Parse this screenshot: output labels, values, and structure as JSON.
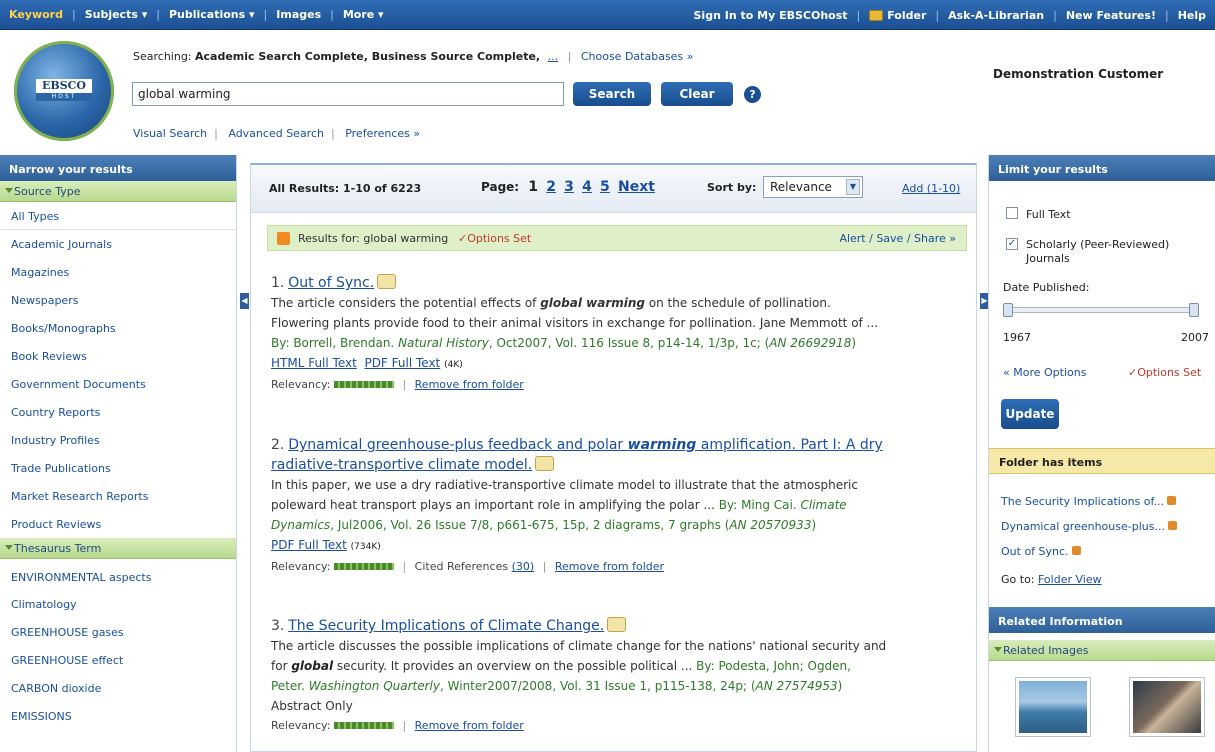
{
  "topnav": {
    "items": [
      "Keyword",
      "Subjects ▾",
      "Publications ▾",
      "Images",
      "More ▾"
    ],
    "right_items": [
      "Sign In to My EBSCOhost",
      "Folder",
      "Ask-A-Librarian",
      "New Features!",
      "Help"
    ]
  },
  "header": {
    "logo_top": "EBSCO",
    "logo_bottom": "HOST",
    "searching_label": "Searching:",
    "databases": "Academic Search Complete, Business Source Complete,",
    "more_ellipsis": "...",
    "choose_databases": "Choose Databases »",
    "search_value": "global warming",
    "search_button": "Search",
    "clear_button": "Clear",
    "help_icon": "?",
    "visual_search": "Visual Search",
    "advanced_search": "Advanced Search",
    "preferences": "Preferences »",
    "customer": "Demonstration Customer"
  },
  "left": {
    "title": "Narrow your results",
    "source_type_title": "Source Type",
    "source_types": [
      "All Types",
      "Academic Journals",
      "Magazines",
      "Newspapers",
      "Books/Monographs",
      "Book Reviews",
      "Government Documents",
      "Country Reports",
      "Industry Profiles",
      "Trade Publications",
      "Market Research Reports",
      "Product Reviews"
    ],
    "thesaurus_title": "Thesaurus Term",
    "thesaurus_terms": [
      "ENVIRONMENTAL aspects",
      "Climatology",
      "GREENHOUSE gases",
      "GREENHOUSE effect",
      "CARBON dioxide",
      "EMISSIONS"
    ]
  },
  "results": {
    "all_results": "All Results: 1-10 of 6223",
    "page_label": "Page:",
    "current_page": "1",
    "pages": [
      "2",
      "3",
      "4",
      "5"
    ],
    "next": "Next",
    "sort_label": "Sort by:",
    "sort_value": "Relevance",
    "add_link": "Add (1-10)",
    "results_for": "Results for: global warming",
    "options_set": "✓Options Set",
    "alert_save_share": "Alert / Save / Share »",
    "records": [
      {
        "num": "1.",
        "title": "Out of Sync.",
        "abstract_1": "The article considers the potential effects of ",
        "abstract_bold": "global warming",
        "abstract_2": " on the schedule of pollination.",
        "abstract_line2": "Flowering plants provide food to their animal visitors in exchange for pollination. Jane Memmott of ...",
        "source_prefix": "By: Borrell, Brendan. ",
        "source_journal": "Natural History",
        "source_rest": ", Oct2007, Vol. 116 Issue 8, p14-14, 1/3p, 1c; (",
        "source_an": "AN 26692918",
        "source_end": ")",
        "links": [
          "HTML Full Text",
          "PDF Full Text"
        ],
        "pdf_size": "(4K)",
        "relevancy": "Relevancy:",
        "actions": [
          "Remove from folder"
        ]
      },
      {
        "num": "2.",
        "title_1": "Dynamical greenhouse-plus feedback and polar ",
        "title_bold": "warming",
        "title_2": " amplification. Part I: A dry",
        "title_line2": "radiative-transportive climate model.",
        "abstract_line1": "In this paper, we use a dry radiative-transportive climate model to illustrate that the atmospheric",
        "abstract_line2": "poleward heat transport plays an important role in amplifying the polar ... ",
        "source_prefix": "By: Ming Cai. ",
        "source_journal_1": "Climate",
        "source_journal_2": "Dynamics",
        "source_rest": ", Jul2006, Vol. 26 Issue 7/8, p661-675, 15p, 2 diagrams, 7 graphs (",
        "source_an": "AN 20570933",
        "source_end": ")",
        "links": [
          "PDF Full Text"
        ],
        "pdf_size": "(734K)",
        "relevancy": "Relevancy:",
        "cited": "Cited References",
        "cited_count": "(30)",
        "actions": [
          "Remove from folder"
        ]
      },
      {
        "num": "3.",
        "title": "The Security Implications of Climate Change.",
        "abstract_line1": "The article discusses the possible implications of climate change for the nations' national security and",
        "abstract_2a": "for ",
        "abstract_bold": "global",
        "abstract_2b": " security. It provides an overview on the possible political ... ",
        "source_prefix_a": "By: Podesta, John; Ogden,",
        "source_prefix_b": "Peter. ",
        "source_journal": "Washington Quarterly",
        "source_rest": ", Winter2007/2008, Vol. 31 Issue 1, p115-138, 24p; (",
        "source_an": "AN 27574953",
        "source_end": ")",
        "abstract_only": "Abstract Only",
        "relevancy": "Relevancy:",
        "actions": [
          "Remove from folder"
        ]
      }
    ]
  },
  "right": {
    "limit_title": "Limit your results",
    "full_text": "Full Text",
    "scholarly_1": "Scholarly  (Peer-Reviewed)",
    "scholarly_2": "Journals",
    "date_published": "Date Published:",
    "date_from": "1967",
    "date_to": "2007",
    "more_options": "« More Options",
    "options_set": "✓Options Set",
    "update_button": "Update",
    "folder_title": "Folder has items",
    "folder_items": [
      "The Security Implications of...",
      "Dynamical greenhouse-plus...",
      "Out of Sync."
    ],
    "goto_label": "Go to:",
    "folder_view": "Folder View",
    "related_title": "Related Information",
    "related_images": "Related Images"
  },
  "colors": {
    "nav": "#1c4f93",
    "accent_green": "#b8d98e",
    "source_green": "#2f7a2a",
    "link": "#1a4fa0"
  }
}
